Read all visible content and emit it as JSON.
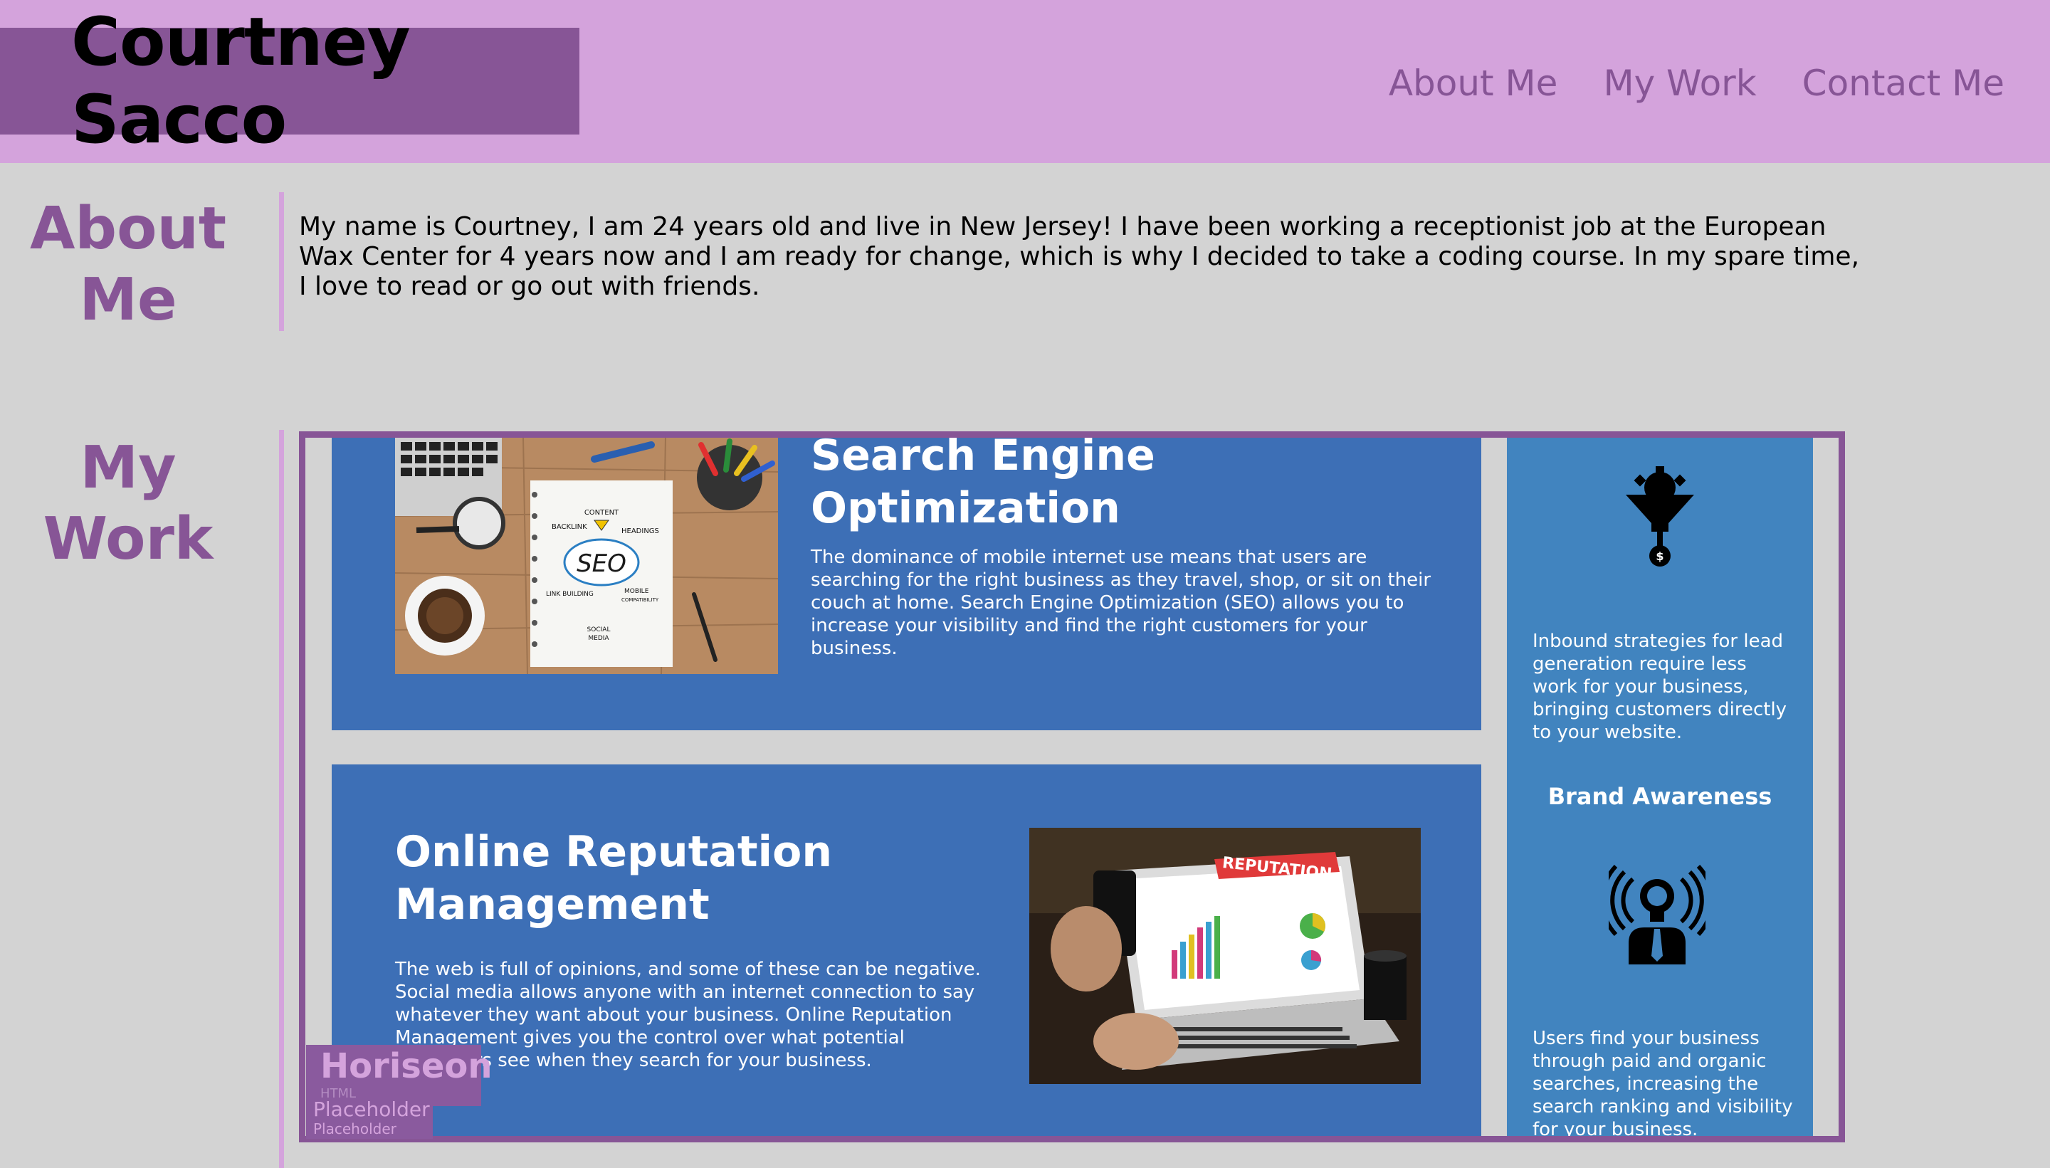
{
  "header": {
    "brand": "Courtney Sacco",
    "nav": [
      "About Me",
      "My Work",
      "Contact Me"
    ]
  },
  "about": {
    "title_line1": "About",
    "title_line2": "Me",
    "text": "My name is Courtney, I am 24 years old and live in New Jersey! I have been working a receptionist job at the European Wax Center for 4 years now and I am ready for change, which is why I decided to take a coding course. In my spare time, I love to read or go out with friends."
  },
  "work": {
    "title_line1": "My",
    "title_line2": "Work",
    "seo": {
      "title_line1": "Search Engine",
      "title_line2": "Optimization",
      "text": "The dominance of mobile internet use means that users are searching for the right business as they travel, shop, or sit on their couch at home. Search Engine Optimization (SEO) allows you to increase your visibility and find the right customers for your business.",
      "image_words": {
        "seo": "SEO",
        "content": "CONTENT",
        "backlink": "BACKLINK",
        "headings": "HEADINGS",
        "link_building": "LINK BUILDING",
        "mobile": "MOBILE",
        "compat": "COMPATIBILITY",
        "social": "SOCIAL",
        "media": "MEDIA"
      }
    },
    "orm": {
      "title_line1": "Online Reputation",
      "title_line2": "Management",
      "text": "The web is full of opinions, and some of these can be negative. Social media allows anyone with an internet connection to say whatever they want about your business. Online Reputation Management gives you the control over what potential customers see when they search for your business.",
      "image_banner": "REPUTATION"
    },
    "sidebar": {
      "lead_text": "Inbound strategies for lead generation require less work for your business, bringing customers directly to your website.",
      "brand_title": "Brand Awareness",
      "brand_text": "Users find your business through paid and organic searches, increasing the search ranking and visibility for your business."
    }
  },
  "overlay": {
    "logo": "Horiseon",
    "logo_sub": "HTML",
    "label": "Placeholder",
    "label_small": "Placeholder"
  },
  "colors": {
    "header_bg": "#d4a3dc",
    "brand_bg": "#875596",
    "page_bg": "#d3d3d3",
    "card_bg": "#3d6fb6",
    "sidebar_bg": "#4184bf"
  }
}
